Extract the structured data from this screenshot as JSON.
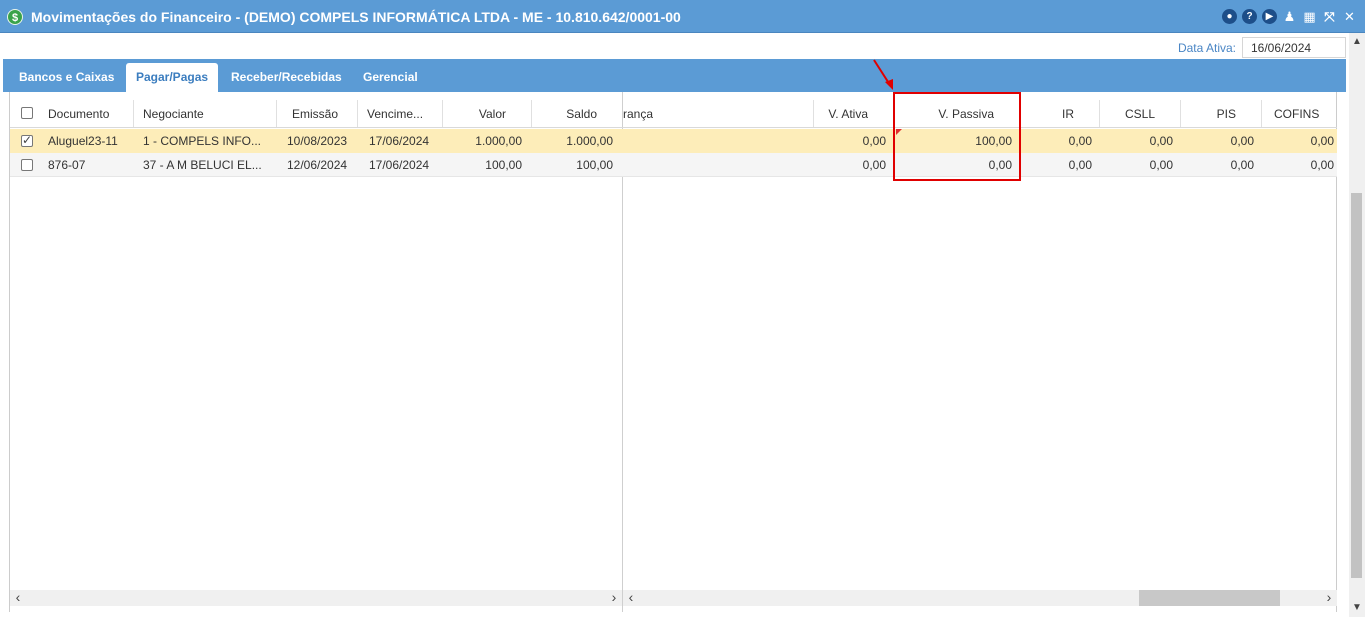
{
  "window": {
    "title": "Movimentações do Financeiro - (DEMO) COMPELS INFORMÁTICA LTDA - ME - 10.810.642/0001-00",
    "icon": "dollar-icon"
  },
  "active_date": {
    "label": "Data Ativa:",
    "value": "16/06/2024"
  },
  "tabs": [
    {
      "label": "Bancos e Caixas",
      "active": false
    },
    {
      "label": "Pagar/Pagas",
      "active": true
    },
    {
      "label": "Receber/Recebidas",
      "active": false
    },
    {
      "label": "Gerencial",
      "active": false
    }
  ],
  "left_columns": {
    "documento": "Documento",
    "negociante": "Negociante",
    "emissao": "Emissão",
    "vencimento": "Vencime...",
    "valor": "Valor",
    "saldo": "Saldo"
  },
  "right_columns": {
    "cobranca": "rança",
    "v_ativa": "V. Ativa",
    "v_passiva": "V. Passiva",
    "ir": "IR",
    "csll": "CSLL",
    "pis": "PIS",
    "cofins": "COFINS"
  },
  "rows": [
    {
      "checked": true,
      "selected": true,
      "documento": "Aluguel23-11",
      "negociante": "1 - COMPELS INFO...",
      "emissao": "10/08/2023",
      "vencimento": "17/06/2024",
      "valor": "1.000,00",
      "saldo": "1.000,00",
      "v_ativa": "0,00",
      "v_passiva": "100,00",
      "ir": "0,00",
      "csll": "0,00",
      "pis": "0,00",
      "cofins": "0,00"
    },
    {
      "checked": false,
      "selected": false,
      "documento": "876-07",
      "negociante": "37 - A M BELUCI EL...",
      "emissao": "12/06/2024",
      "vencimento": "17/06/2024",
      "valor": "100,00",
      "saldo": "100,00",
      "v_ativa": "0,00",
      "v_passiva": "0,00",
      "ir": "0,00",
      "csll": "0,00",
      "pis": "0,00",
      "cofins": "0,00"
    }
  ],
  "colors": {
    "title_bar": "#5b9bd5",
    "selected_row": "#fdedb9",
    "highlight": "#e00000",
    "accent_text": "#4a86c5"
  }
}
